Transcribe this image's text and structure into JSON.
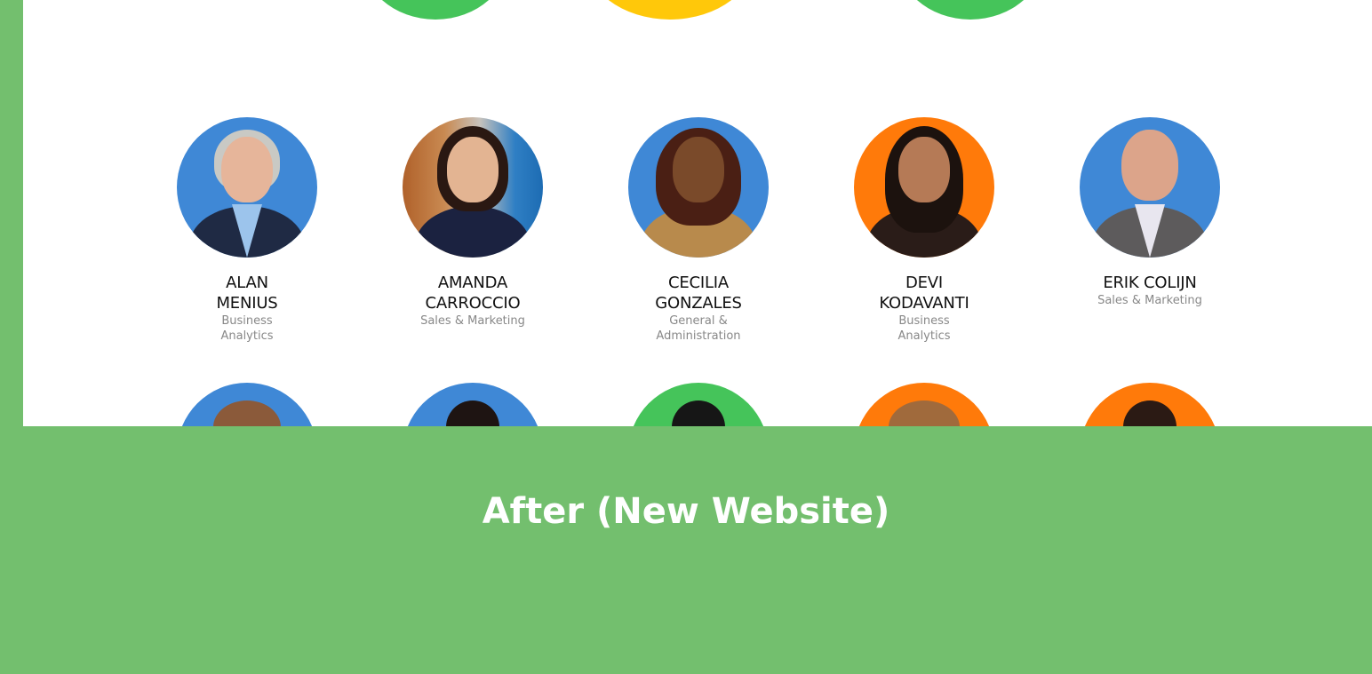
{
  "caption": "After (New Website)",
  "colors": {
    "frame_green": "#73bf6e",
    "avatar_blue": "#3f88d6",
    "avatar_orange": "#ff7a0a",
    "avatar_green": "#45c45a",
    "accent_yellow": "#ffc80a"
  },
  "team": [
    {
      "name_line1": "ALAN",
      "name_line2": "MENIUS",
      "dept_line1": "Business",
      "dept_line2": "Analytics",
      "bg": "avatar_blue"
    },
    {
      "name_line1": "AMANDA",
      "name_line2": "CARROCCIO",
      "dept_line1": "Sales & Marketing",
      "dept_line2": "",
      "bg": "photo"
    },
    {
      "name_line1": "CECILIA",
      "name_line2": "GONZALES",
      "dept_line1": "General &",
      "dept_line2": "Administration",
      "bg": "avatar_blue"
    },
    {
      "name_line1": "DEVI",
      "name_line2": "KODAVANTI",
      "dept_line1": "Business",
      "dept_line2": "Analytics",
      "bg": "avatar_orange"
    },
    {
      "name_line1": "ERIK COLIJN",
      "name_line2": "",
      "dept_line1": "Sales & Marketing",
      "dept_line2": "",
      "bg": "avatar_blue"
    }
  ],
  "next_row_backgrounds": [
    "avatar_blue",
    "avatar_blue",
    "avatar_green",
    "avatar_orange",
    "avatar_orange"
  ]
}
